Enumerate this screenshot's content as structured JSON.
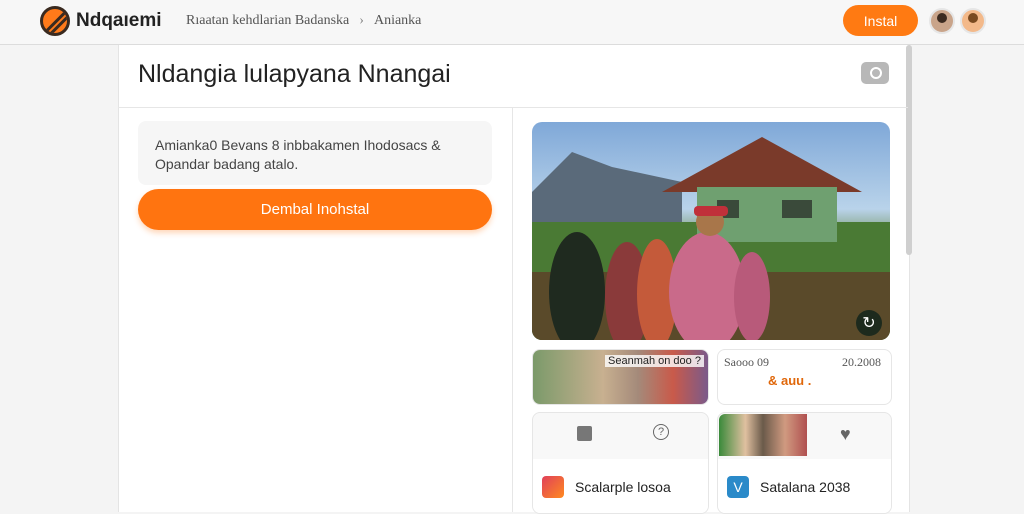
{
  "header": {
    "app_name": "Ndqaıemi",
    "breadcrumb": [
      "Rıaatan kehdlarian Badanska",
      "Anianka"
    ],
    "breadcrumb_separator": "›",
    "install_label": "Instal"
  },
  "page": {
    "title": "Nldangia lulapyana Nnangai"
  },
  "info_card": {
    "text": "Amianka0 Bevans 8 inbbakamen Ihodosacs & Opandar badang atalo.",
    "cta_label": "Dembal Inohstal"
  },
  "tiles": {
    "media_label": "Seanmah on doo ?",
    "stat_left": "Saooo 09",
    "stat_right": "20.2008",
    "stat_value": "& auu .",
    "row1_label": "Scalarple losoa",
    "row2_label": "Satalana 2038",
    "row2_badge": "V"
  },
  "colors": {
    "accent": "#ff7410",
    "background": "#f4f4f4",
    "panel": "#ffffff"
  },
  "icons": [
    "logo-icon",
    "camera-icon",
    "refresh-icon",
    "bag-icon",
    "info-icon",
    "heart-icon"
  ]
}
